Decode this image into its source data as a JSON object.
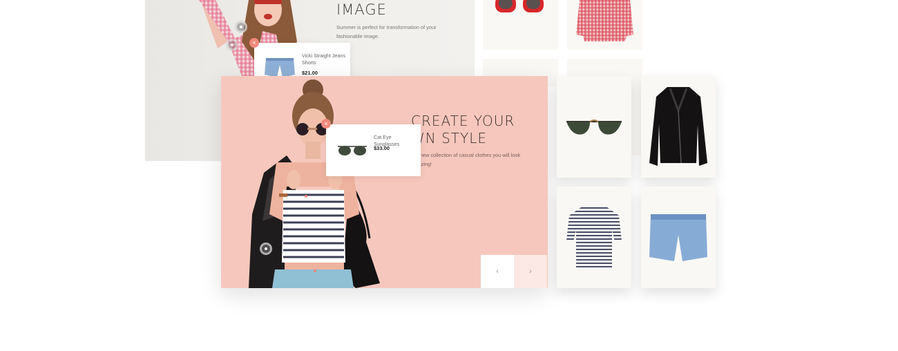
{
  "back_slide": {
    "title": "IMAGE",
    "description": "Summer is perfect for transformation of your fashionable image.",
    "popup": {
      "product_name": "Vicki Straight Jeans Shorts",
      "price": "$21.00"
    }
  },
  "front_slide": {
    "title_line1": "CREATE YOUR",
    "title_line2": "WN STYLE",
    "description": "our new collection of casual clothes you will look amazing!",
    "popup": {
      "product_name": "Cat Eye Sunglasses",
      "price": "$33.00"
    },
    "nav": {
      "prev": "‹",
      "next": "›"
    }
  },
  "thumbnails": [
    {
      "name": "red-sunglasses"
    },
    {
      "name": "pink-gingham-shirt"
    },
    {
      "name": "black-sunglasses"
    },
    {
      "name": "black-leather-jacket"
    },
    {
      "name": "striped-tshirt"
    },
    {
      "name": "denim-shorts"
    }
  ],
  "colors": {
    "accent": "#f08a7d",
    "slide_bg": "#f6c8bd"
  }
}
